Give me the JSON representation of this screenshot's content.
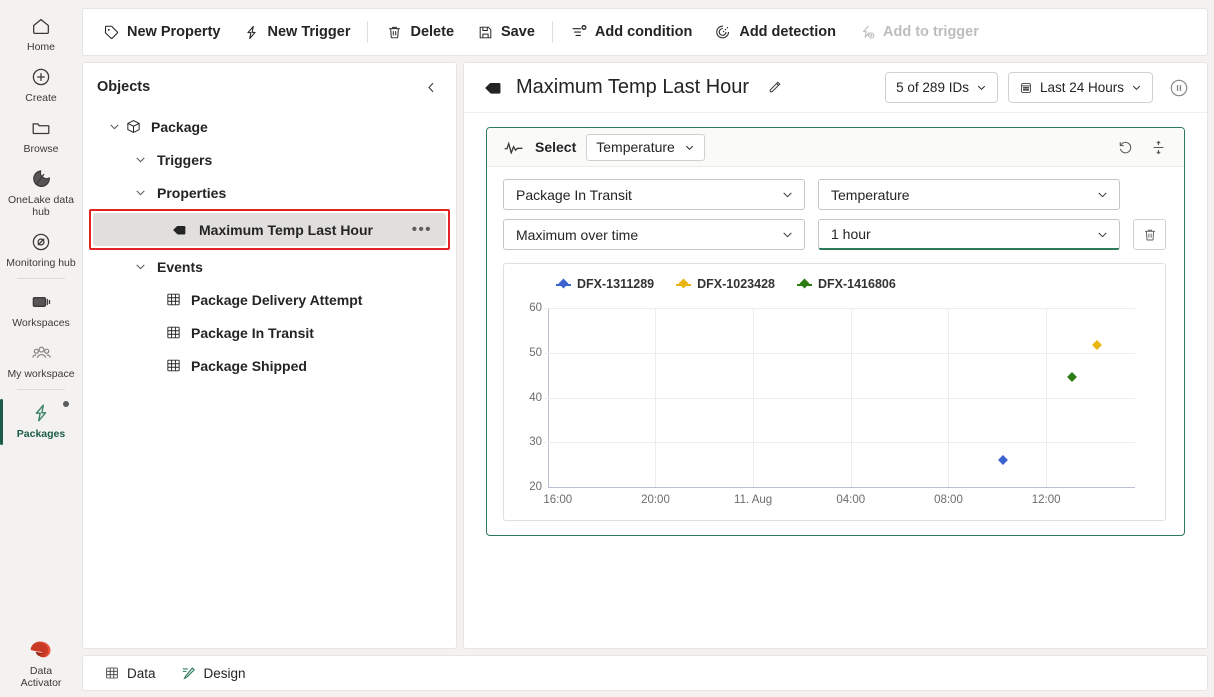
{
  "rail": {
    "items": [
      {
        "label": "Home",
        "icon": "home-icon",
        "active": false
      },
      {
        "label": "Create",
        "icon": "plus-circle-icon",
        "active": false
      },
      {
        "label": "Browse",
        "icon": "folder-icon",
        "active": false
      },
      {
        "label": "OneLake data hub",
        "icon": "onelake-icon",
        "active": false
      },
      {
        "label": "Monitoring hub",
        "icon": "monitoring-icon",
        "active": false
      },
      {
        "label": "Workspaces",
        "icon": "workspaces-icon",
        "active": false
      },
      {
        "label": "My workspace",
        "icon": "people-icon",
        "active": false
      },
      {
        "label": "Packages",
        "icon": "activator-bolt-icon",
        "active": true
      }
    ],
    "footer": {
      "label_line1": "Data",
      "label_line2": "Activator",
      "icon": "data-activator-logo"
    }
  },
  "toolbar": {
    "buttons": [
      {
        "label": "New Property",
        "icon": "tag-icon",
        "disabled": false
      },
      {
        "label": "New Trigger",
        "icon": "bolt-icon",
        "disabled": false
      },
      {
        "label": "Delete",
        "icon": "trash-icon",
        "disabled": false
      },
      {
        "label": "Save",
        "icon": "save-disk-icon",
        "disabled": false
      },
      {
        "label": "Add condition",
        "icon": "add-condition-icon",
        "disabled": false
      },
      {
        "label": "Add detection",
        "icon": "add-detection-icon",
        "disabled": false
      },
      {
        "label": "Add to trigger",
        "icon": "add-to-trigger-icon",
        "disabled": true
      }
    ]
  },
  "objects": {
    "title": "Objects",
    "collapse_icon": "chevron-left-icon",
    "tree": [
      {
        "label": "Package",
        "icon": "cube-icon",
        "indent": 0,
        "expanded": true,
        "selected": false,
        "has_chevron": true
      },
      {
        "label": "Triggers",
        "icon": "",
        "indent": 1,
        "expanded": true,
        "selected": false,
        "has_chevron": true
      },
      {
        "label": "Properties",
        "icon": "",
        "indent": 1,
        "expanded": true,
        "selected": false,
        "has_chevron": true
      },
      {
        "label": "Maximum Temp Last Hour",
        "icon": "tag-icon",
        "indent": 2,
        "expanded": false,
        "selected": true,
        "has_chevron": false,
        "menu": "•••"
      },
      {
        "label": "Events",
        "icon": "",
        "indent": 1,
        "expanded": true,
        "selected": false,
        "has_chevron": true
      },
      {
        "label": "Package Delivery Attempt",
        "icon": "table-icon",
        "indent": 2,
        "expanded": false,
        "selected": false,
        "has_chevron": false
      },
      {
        "label": "Package In Transit",
        "icon": "table-icon",
        "indent": 2,
        "expanded": false,
        "selected": false,
        "has_chevron": false
      },
      {
        "label": "Package Shipped",
        "icon": "table-icon",
        "indent": 2,
        "expanded": false,
        "selected": false,
        "has_chevron": false
      }
    ]
  },
  "main": {
    "title": "Maximum Temp Last Hour",
    "title_icon": "tag-icon",
    "edit_icon": "pencil-icon",
    "id_filter": {
      "label": "5 of 289 IDs",
      "caret": "chevron-down-icon"
    },
    "time_range": {
      "label": "Last 24 Hours",
      "icon": "calendar-icon",
      "caret": "chevron-down-icon"
    },
    "pause": {
      "icon": "pause-circle-icon"
    }
  },
  "query_card": {
    "spark_icon": "sparkline-icon",
    "select_label": "Select",
    "select_value": "Temperature",
    "refresh_icon": "reset-icon",
    "axis_icon": "axis-split-icon",
    "dropdowns": [
      {
        "value": "Package In Transit",
        "accent": false
      },
      {
        "value": "Temperature",
        "accent": false
      },
      {
        "value": "Maximum over time",
        "accent": false
      },
      {
        "value": "1 hour",
        "accent": true
      }
    ],
    "delete_icon": "trash-icon"
  },
  "chart_data": {
    "type": "scatter",
    "title": "",
    "xlabel": "",
    "ylabel": "",
    "ylim": [
      20,
      60
    ],
    "yticks": [
      20,
      30,
      40,
      50,
      60
    ],
    "xticks": [
      "16:00",
      "20:00",
      "11. Aug",
      "04:00",
      "08:00",
      "12:00"
    ],
    "grid": true,
    "legend_position": "top-left",
    "series": [
      {
        "name": "DFX-1311289",
        "color": "#3a63d0",
        "points": [
          {
            "x": "10:00",
            "x_frac": 0.775,
            "y": 26.0
          }
        ]
      },
      {
        "name": "DFX-1023428",
        "color": "#e8b512",
        "points": [
          {
            "x": "14:00",
            "x_frac": 0.935,
            "y": 51.7
          }
        ]
      },
      {
        "name": "DFX-1416806",
        "color": "#2d7d14",
        "points": [
          {
            "x": "12:50",
            "x_frac": 0.893,
            "y": 44.5
          }
        ]
      }
    ]
  },
  "statusbar": {
    "tabs": [
      {
        "label": "Data",
        "icon": "table-icon"
      },
      {
        "label": "Design",
        "icon": "design-pen-icon"
      }
    ]
  },
  "colors": {
    "accent_green": "#2b7a5a",
    "rail_active": "#1b5c4a",
    "highlight_red": "#e02424",
    "series_blue": "#3a63d0",
    "series_yellow": "#e8b512",
    "series_green": "#2d7d14"
  }
}
